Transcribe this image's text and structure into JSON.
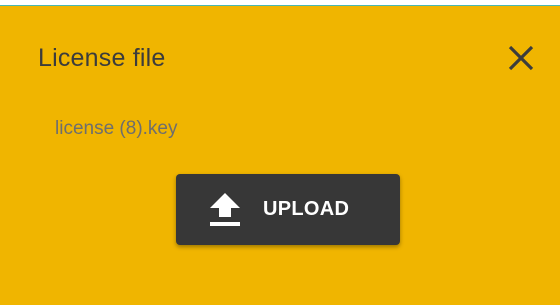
{
  "dialog": {
    "title": "License file",
    "file_name": "license (8).key",
    "upload_label": "UPLOAD",
    "close_icon": "close-icon",
    "upload_icon": "upload-icon"
  },
  "colors": {
    "background": "#f0b500",
    "button": "#373737",
    "title_text": "#3c3c3c",
    "file_text": "#6e6e6e"
  }
}
